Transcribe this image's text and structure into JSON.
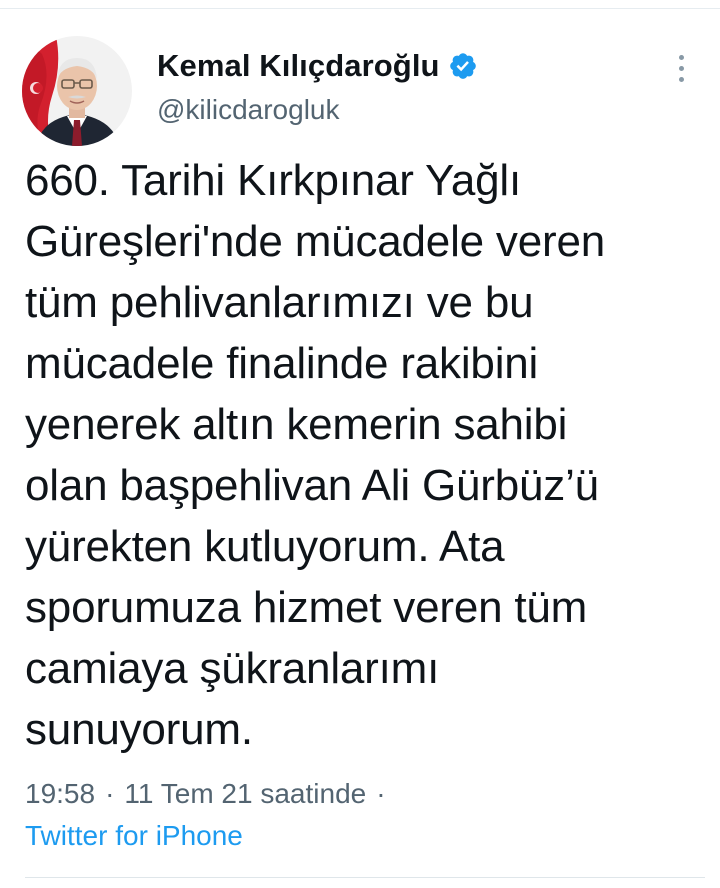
{
  "tweet": {
    "author": {
      "display_name": "Kemal Kılıçdaroğlu",
      "handle": "@kilicdarogluk",
      "verified": true,
      "verified_icon": "verified-badge-icon",
      "avatar": "profile-avatar"
    },
    "text_lines": [
      "660. Tarihi Kırkpınar Yağlı",
      "Güreşleri'nde mücadele veren",
      "tüm pehlivanlarımızı ve bu",
      "mücadele finalinde rakibini",
      "yenerek altın kemerin sahibi",
      "olan başpehlivan Ali Gürbüz’ü",
      "yürekten kutluyorum. Ata",
      "sporumuza hizmet veren tüm",
      "camiaya şükranlarımı",
      "sunuyorum."
    ],
    "time": "19:58",
    "separator": "·",
    "date": "11 Tem 21 saatinde",
    "trailing_separator": "·",
    "source": "Twitter for iPhone"
  },
  "icons": {
    "more": "more-vertical-icon"
  },
  "colors": {
    "text_primary": "#0f1419",
    "text_secondary": "#536471",
    "link": "#1d9bf0",
    "verified": "#1d9bf0",
    "divider": "#e6ecf0"
  }
}
